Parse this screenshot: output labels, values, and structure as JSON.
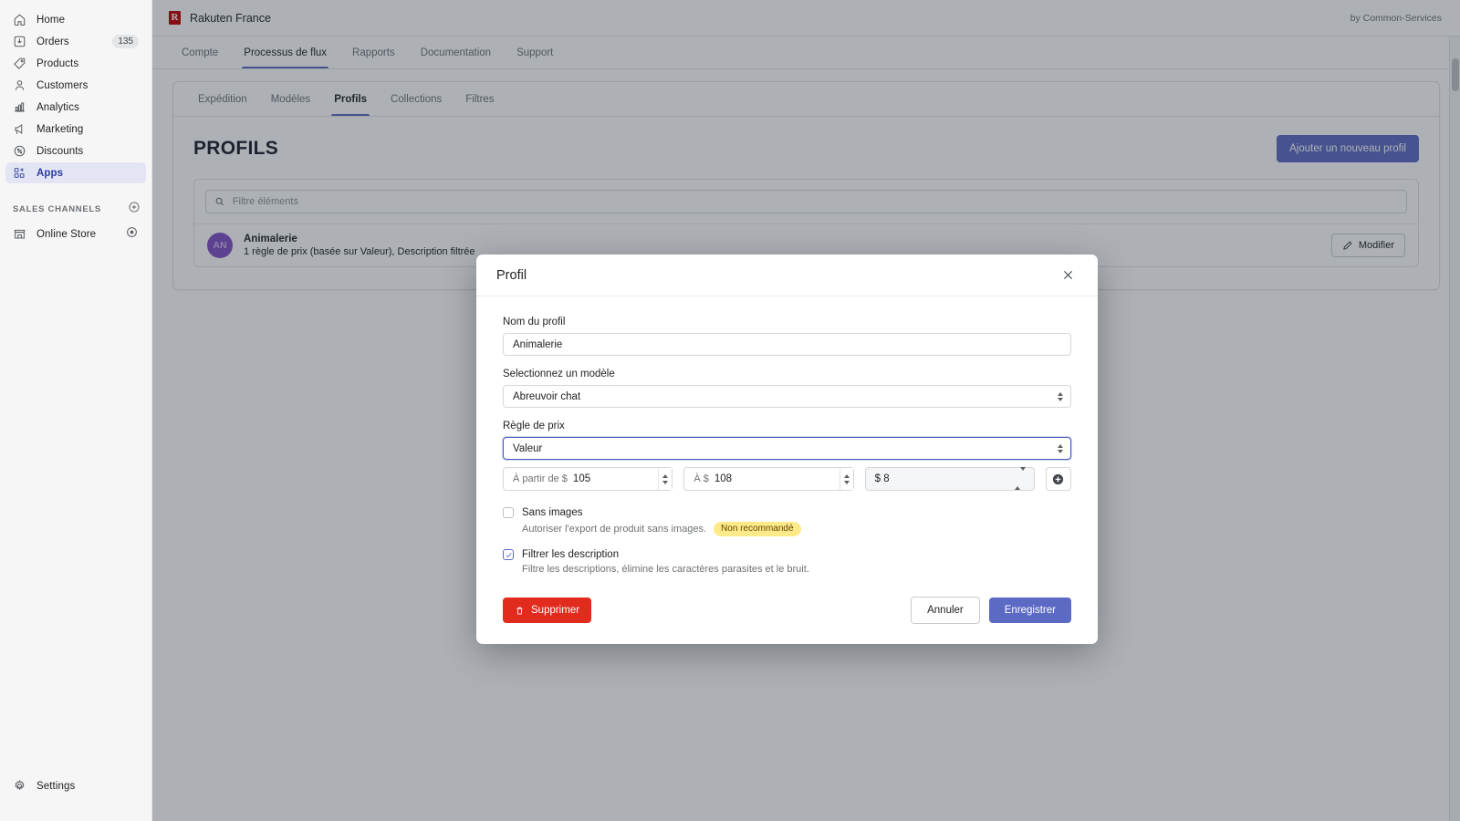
{
  "sidebar": {
    "items": [
      {
        "label": "Home",
        "icon": "home-icon",
        "badge": null,
        "active": false
      },
      {
        "label": "Orders",
        "icon": "orders-icon",
        "badge": "135",
        "active": false
      },
      {
        "label": "Products",
        "icon": "products-icon",
        "badge": null,
        "active": false
      },
      {
        "label": "Customers",
        "icon": "customers-icon",
        "badge": null,
        "active": false
      },
      {
        "label": "Analytics",
        "icon": "analytics-icon",
        "badge": null,
        "active": false
      },
      {
        "label": "Marketing",
        "icon": "marketing-icon",
        "badge": null,
        "active": false
      },
      {
        "label": "Discounts",
        "icon": "discounts-icon",
        "badge": null,
        "active": false
      },
      {
        "label": "Apps",
        "icon": "apps-icon",
        "badge": null,
        "active": true
      }
    ],
    "section_title": "SALES CHANNELS",
    "channels": [
      {
        "label": "Online Store",
        "icon": "store-icon",
        "trailing_icon": "eye-icon"
      }
    ],
    "settings_label": "Settings",
    "settings_icon": "gear-icon"
  },
  "header": {
    "logo_text": "R",
    "app_title": "Rakuten France",
    "byline": "by Common-Services",
    "accent_color": "#5c6ac4",
    "logo_color": "#bf0000"
  },
  "top_tabs": [
    {
      "label": "Compte",
      "active": false
    },
    {
      "label": "Processus de flux",
      "active": true
    },
    {
      "label": "Rapports",
      "active": false
    },
    {
      "label": "Documentation",
      "active": false
    },
    {
      "label": "Support",
      "active": false
    }
  ],
  "sub_tabs": [
    {
      "label": "Expédition",
      "active": false
    },
    {
      "label": "Modèles",
      "active": false
    },
    {
      "label": "Profils",
      "active": true
    },
    {
      "label": "Collections",
      "active": false
    },
    {
      "label": "Filtres",
      "active": false
    }
  ],
  "page": {
    "title": "PROFILS",
    "add_button": "Ajouter un nouveau profil",
    "filter_placeholder": "Filtre éléments",
    "filter_value": "",
    "filter_icon": "search-icon",
    "profiles": [
      {
        "initials": "AN",
        "name": "Animalerie",
        "subtitle": "1 règle de prix (basée sur Valeur), Description filtrée",
        "edit_label": "Modifier",
        "edit_icon": "pencil-icon"
      }
    ]
  },
  "modal": {
    "title": "Profil",
    "close_icon": "close-icon",
    "profile_name_label": "Nom du profil",
    "profile_name_value": "Animalerie",
    "template_label": "Selectionnez un modèle",
    "template_value": "Abreuvoir chat",
    "price_rule_label": "Règle de prix",
    "price_rule_value": "Valeur",
    "price_from_prefix": "À partir de $",
    "price_from_value": "105",
    "price_to_prefix": "À $",
    "price_to_value": "108",
    "price_amount_value": "$ 8",
    "add_rule_icon": "plus-circle-icon",
    "no_images": {
      "label": "Sans images",
      "description": "Autoriser l'export de produit sans images.",
      "pill": "Non recommandé",
      "checked": false
    },
    "filter_description": {
      "label": "Filtrer les description",
      "description": "Filtre les descriptions, élimine les caractères parasites et le bruit.",
      "checked": true
    },
    "delete_label": "Supprimer",
    "delete_icon": "trash-icon",
    "cancel_label": "Annuler",
    "save_label": "Enregistrer",
    "delete_color": "#e02b1d",
    "save_color": "#5c6ac4"
  }
}
